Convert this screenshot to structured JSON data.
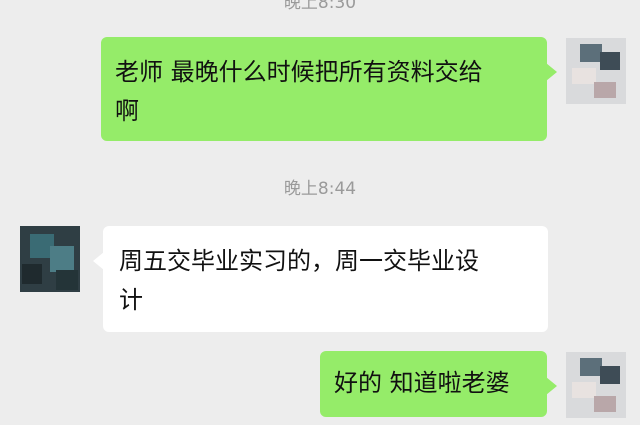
{
  "chat": {
    "timestamp_top": "晚上8:30",
    "timestamp_mid": "晚上8:44",
    "messages": [
      {
        "sender": "me",
        "text": "老师  最晚什么时候把所有资料交给\n啊"
      },
      {
        "sender": "other",
        "text": "周五交毕业实习的，周一交毕业设\n计"
      },
      {
        "sender": "me",
        "text": "好的 知道啦老婆"
      }
    ]
  },
  "colors": {
    "background": "#ededed",
    "my_bubble": "#95ec69",
    "other_bubble": "#ffffff",
    "timestamp_text": "#9a9a9a"
  }
}
